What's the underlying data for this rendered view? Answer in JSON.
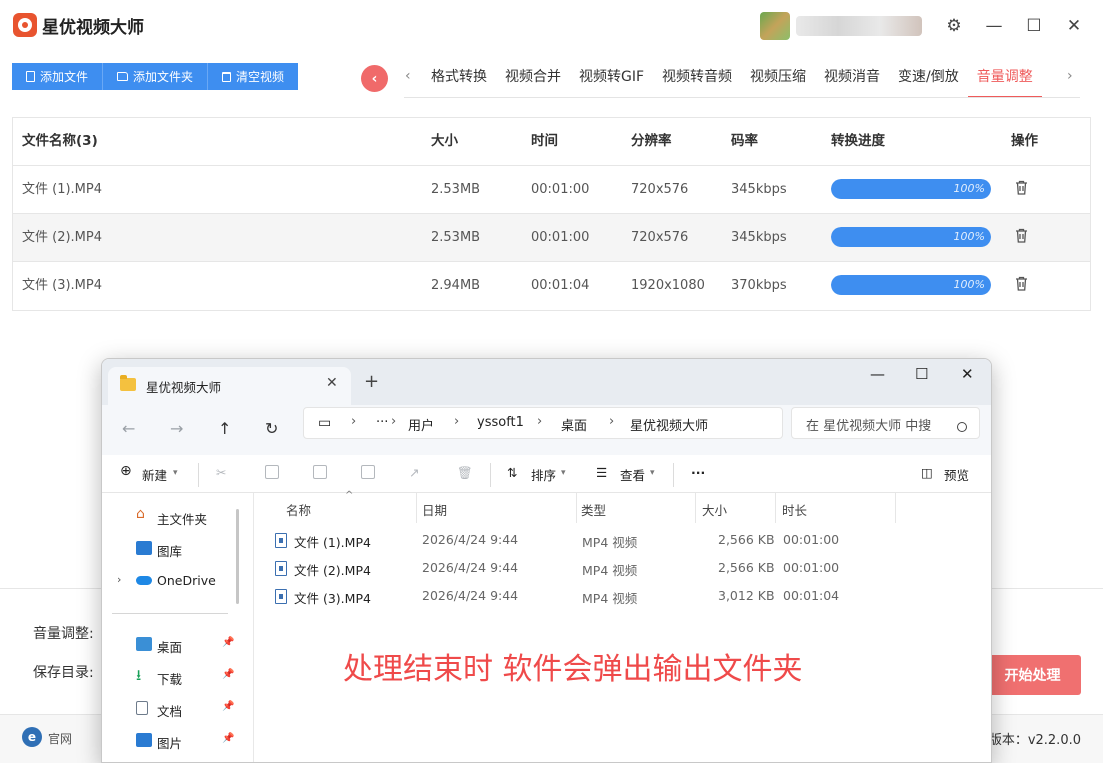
{
  "app": {
    "title": "星优视频大师",
    "window_controls": [
      "⚙",
      "—",
      "☐",
      "✕"
    ]
  },
  "toolbar": {
    "add_file": "添加文件",
    "add_folder": "添加文件夹",
    "clear_video": "清空视频"
  },
  "tabs": [
    "格式转换",
    "视频合并",
    "视频转GIF",
    "视频转音频",
    "视频压缩",
    "视频消音",
    "变速/倒放",
    "音量调整"
  ],
  "active_tab": "音量调整",
  "table": {
    "headers": [
      "文件名称(3)",
      "大小",
      "时间",
      "分辨率",
      "码率",
      "转换进度",
      "操作"
    ],
    "rows": [
      {
        "name": "文件 (1).MP4",
        "size": "2.53MB",
        "time": "00:01:00",
        "resolution": "720x576",
        "bitrate": "345kbps",
        "progress": "100%",
        "progress_value": 100
      },
      {
        "name": "文件 (2).MP4",
        "size": "2.53MB",
        "time": "00:01:00",
        "resolution": "720x576",
        "bitrate": "345kbps",
        "progress": "100%",
        "progress_value": 100
      },
      {
        "name": "文件 (3).MP4",
        "size": "2.94MB",
        "time": "00:01:04",
        "resolution": "1920x1080",
        "bitrate": "370kbps",
        "progress": "100%",
        "progress_value": 100
      }
    ]
  },
  "bottom": {
    "volume_label": "音量调整:",
    "save_label": "保存目录:",
    "start_button": "开始处理",
    "footer_link": "官网",
    "footer_logo": "e",
    "version": "版本：v2.2.0.0"
  },
  "explorer": {
    "tab_title": "星优视频大师",
    "breadcrumb": [
      "用户",
      "yssoft1",
      "桌面",
      "星优视频大师"
    ],
    "ellipsis": "···",
    "search_placeholder": "在 星优视频大师 中搜",
    "commands": {
      "new": "新建",
      "sort": "排序",
      "view": "查看",
      "more": "···",
      "preview": "预览"
    },
    "sidebar": [
      {
        "label": "主文件夹",
        "icon": "home-icon",
        "pinned": false
      },
      {
        "label": "图库",
        "icon": "gallery-icon",
        "pinned": false
      },
      {
        "label": "OneDrive",
        "icon": "cloud-icon",
        "pinned": false
      },
      {
        "label": "桌面",
        "icon": "desktop-icon",
        "pinned": true
      },
      {
        "label": "下载",
        "icon": "download-icon",
        "pinned": true
      },
      {
        "label": "文档",
        "icon": "document-icon",
        "pinned": true
      },
      {
        "label": "图片",
        "icon": "picture-icon",
        "pinned": true
      }
    ],
    "columns": [
      "名称",
      "日期",
      "类型",
      "大小",
      "时长"
    ],
    "files": [
      {
        "name": "文件 (1).MP4",
        "date": "2026/4/24 9:44",
        "type": "MP4 视频",
        "size": "2,566 KB",
        "duration": "00:01:00"
      },
      {
        "name": "文件 (2).MP4",
        "date": "2026/4/24 9:44",
        "type": "MP4 视频",
        "size": "2,566 KB",
        "duration": "00:01:00"
      },
      {
        "name": "文件 (3).MP4",
        "date": "2026/4/24 9:44",
        "type": "MP4 视频",
        "size": "3,012 KB",
        "duration": "00:01:04"
      }
    ]
  },
  "notice": "处理结束时 软件会弹出输出文件夹",
  "colors": {
    "accent_blue": "#3e8ef0",
    "accent_red": "#ef5b5b",
    "notice_red": "#ef4a4a"
  }
}
